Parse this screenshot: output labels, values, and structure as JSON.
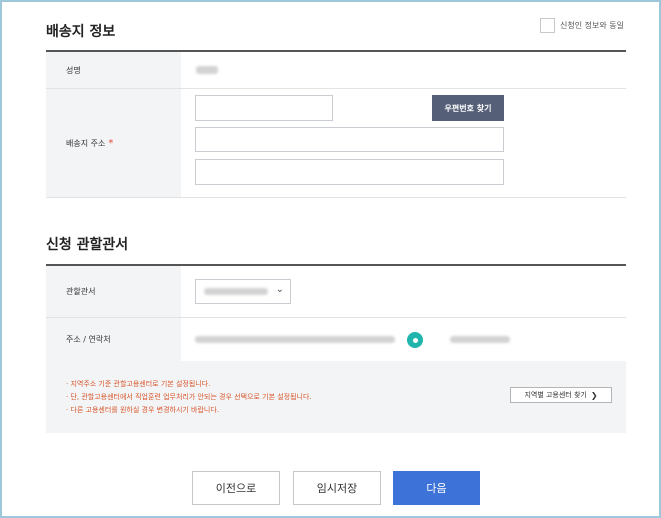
{
  "shipping": {
    "title": "배송지 정보",
    "same_as_applicant": "신청인 정보와 동일",
    "name_label": "성명",
    "address_label": "배송지 주소",
    "required_mark": "*",
    "zip_button": "우편번호 찾기"
  },
  "office": {
    "title": "신청 관할관서",
    "office_label": "관할관서",
    "contact_label": "주소 / 연락처",
    "notes": [
      "· 지역주소 기준 관할고용센터로 기본 설정됩니다.",
      "· 단, 관할고용센터에서 직업훈련 업무처리가 안되는 경우 선택으로 기본 설정됩니다.",
      "· 다른 고용센터를 원하실 경우 변경하시기 바랍니다."
    ],
    "region_button": "지역별 고용센터 찾기",
    "region_arrow": "❯"
  },
  "footer": {
    "prev": "이전으로",
    "temp_save": "임시저장",
    "next": "다음"
  },
  "colors": {
    "primary": "#3d73d8",
    "zip_button": "#555f78",
    "required": "#e8483b",
    "note_text": "#d8562b",
    "pin": "#1fb5ad"
  }
}
